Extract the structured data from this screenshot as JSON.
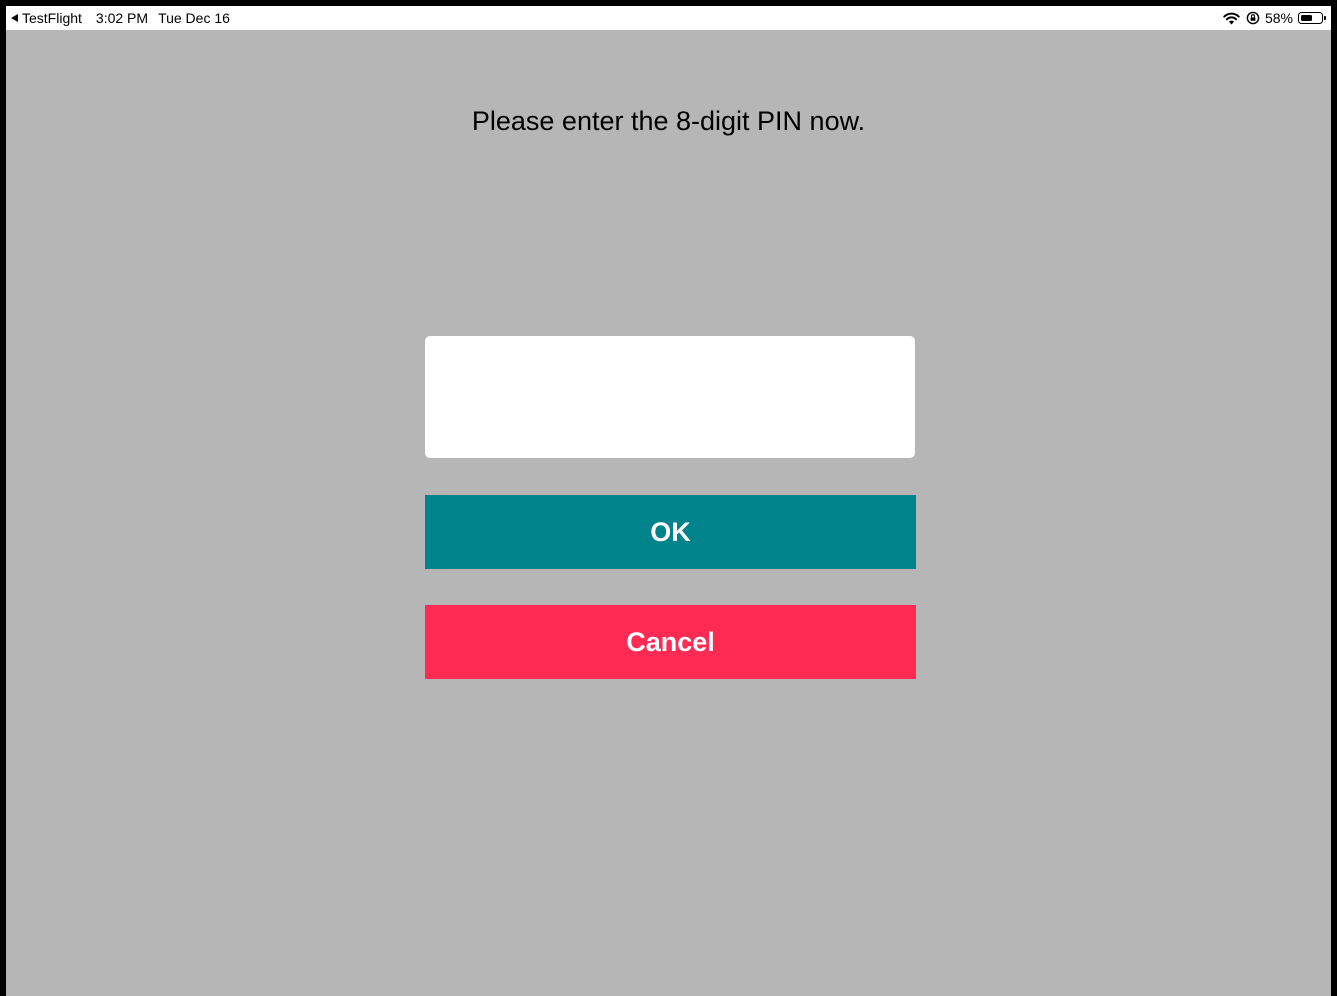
{
  "status_bar": {
    "back_app": "TestFlight",
    "time": "3:02 PM",
    "date": "Tue Dec 16",
    "battery_percent": "58%",
    "battery_level": 0.58,
    "icons": [
      "wifi-icon",
      "orientation-lock-icon",
      "battery-icon"
    ]
  },
  "prompt": {
    "text": "Please enter the 8-digit PIN now."
  },
  "pin_input": {
    "value": "",
    "placeholder": ""
  },
  "buttons": {
    "ok_label": "OK",
    "cancel_label": "Cancel"
  },
  "colors": {
    "background": "#b6b6b6",
    "ok_button": "#00838a",
    "cancel_button": "#ff2b55",
    "input_background": "#ffffff"
  }
}
